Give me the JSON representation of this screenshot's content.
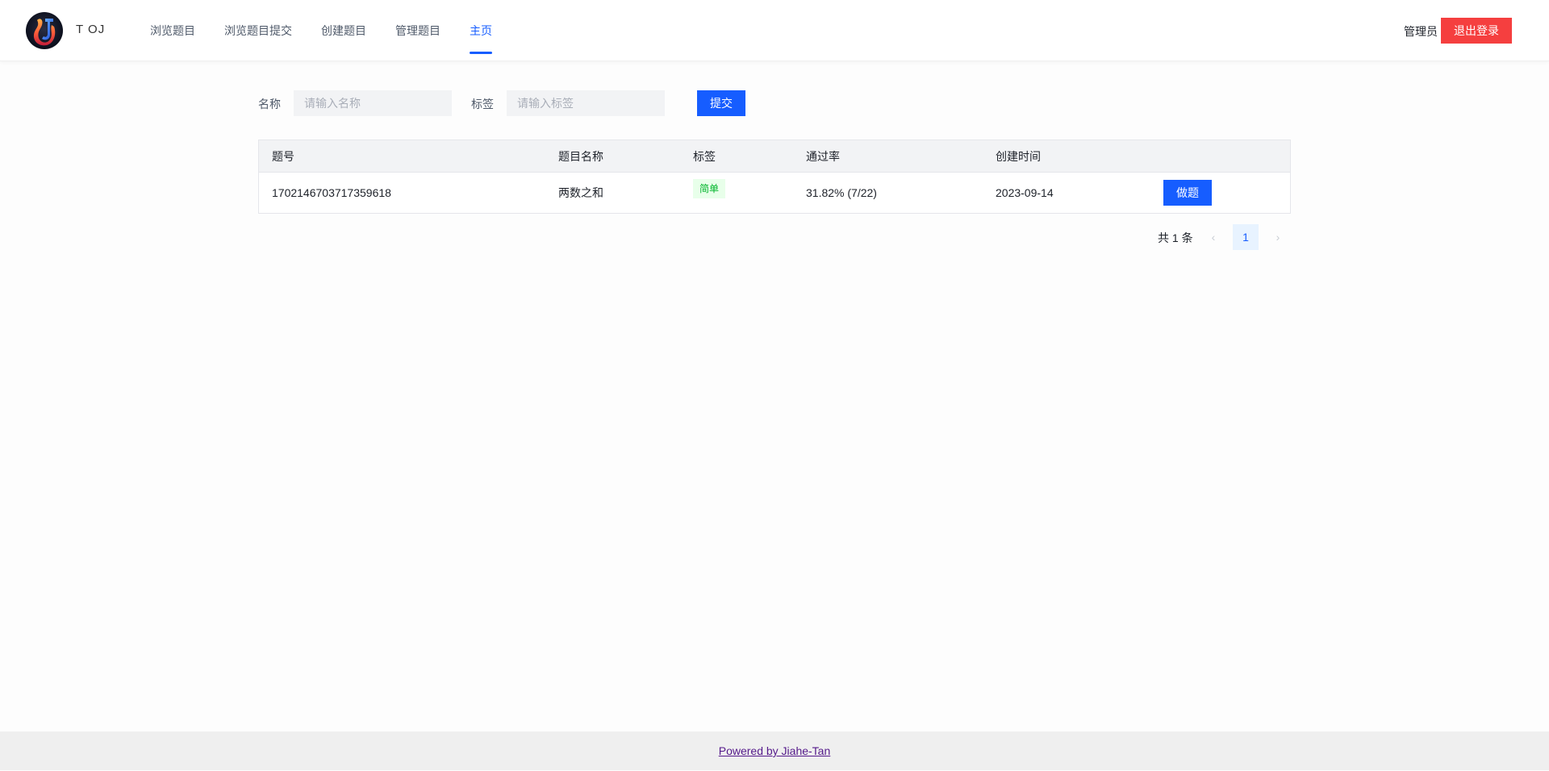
{
  "header": {
    "logo_icon": "oj-flame-logo",
    "brand": "T OJ",
    "nav": [
      {
        "label": "浏览题目",
        "active": false
      },
      {
        "label": "浏览题目提交",
        "active": false
      },
      {
        "label": "创建题目",
        "active": false
      },
      {
        "label": "管理题目",
        "active": false
      },
      {
        "label": "主页",
        "active": true
      }
    ],
    "user_role": "管理员",
    "logout_label": "退出登录"
  },
  "search": {
    "name_label": "名称",
    "name_placeholder": "请输入名称",
    "name_value": "",
    "tag_label": "标签",
    "tag_placeholder": "请输入标签",
    "tag_value": "",
    "submit_label": "提交"
  },
  "table": {
    "columns": [
      "题号",
      "题目名称",
      "标签",
      "通过率",
      "创建时间",
      ""
    ],
    "rows": [
      {
        "id": "1702146703717359618",
        "title": "两数之和",
        "tag": "简单",
        "pass_rate": "31.82% (7/22)",
        "created": "2023-09-14",
        "action": "做题"
      }
    ]
  },
  "pagination": {
    "total": "共 1 条",
    "prev_icon": "chevron-left-icon",
    "current_page": "1",
    "next_icon": "chevron-right-icon"
  },
  "footer": {
    "link": "Powered by Jiahe-Tan"
  },
  "colors": {
    "primary": "#165dff",
    "danger": "#f53f3f",
    "tag_text": "#00b42a",
    "tag_bg": "#e8ffea"
  }
}
